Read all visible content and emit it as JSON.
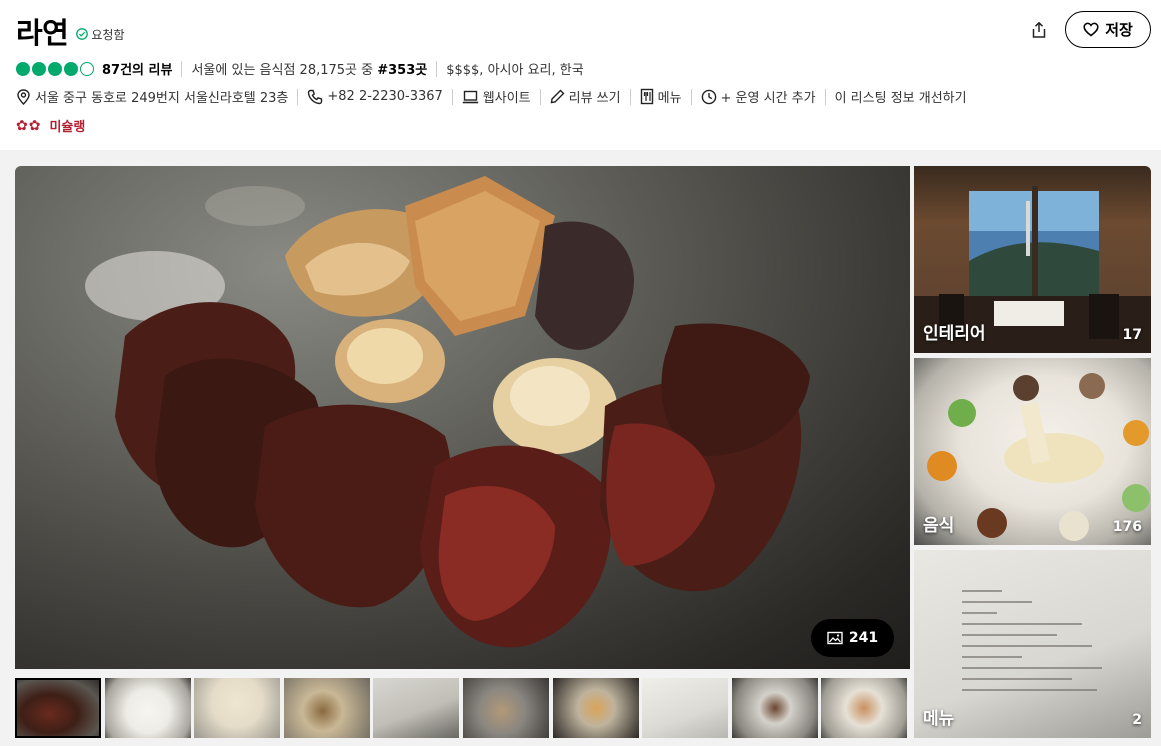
{
  "listing": {
    "title": "라연",
    "claimed_label": "요청함",
    "save_label": "저장",
    "share_icon": "share-icon",
    "heart_icon": "heart-icon"
  },
  "rating": {
    "bubbles_filled": 4,
    "bubbles_total": 5,
    "review_count": "87건의 리뷰",
    "rank_prefix": "서울에 있는 음식점 28,175곳 중 ",
    "rank_value": "#353곳",
    "tags": "$$$$, 아시아 요리, 한국",
    "accent_color": "#00aa6c"
  },
  "info": {
    "address": "서울 중구 동호로 249번지 서울신라호텔 23층",
    "phone": "+82 2-2230-3367",
    "website": "웹사이트",
    "write_review": "리뷰 쓰기",
    "menu": "메뉴",
    "add_hours": "+ 운영 시간 추가",
    "improve": "이 리스팅 정보 개선하기"
  },
  "michelin": {
    "label": "미슐랭",
    "color": "#b32133"
  },
  "gallery": {
    "total_photos": "241",
    "tiles": [
      {
        "label": "인테리어",
        "count": "17"
      },
      {
        "label": "음식",
        "count": "176"
      },
      {
        "label": "메뉴",
        "count": "2"
      }
    ]
  }
}
